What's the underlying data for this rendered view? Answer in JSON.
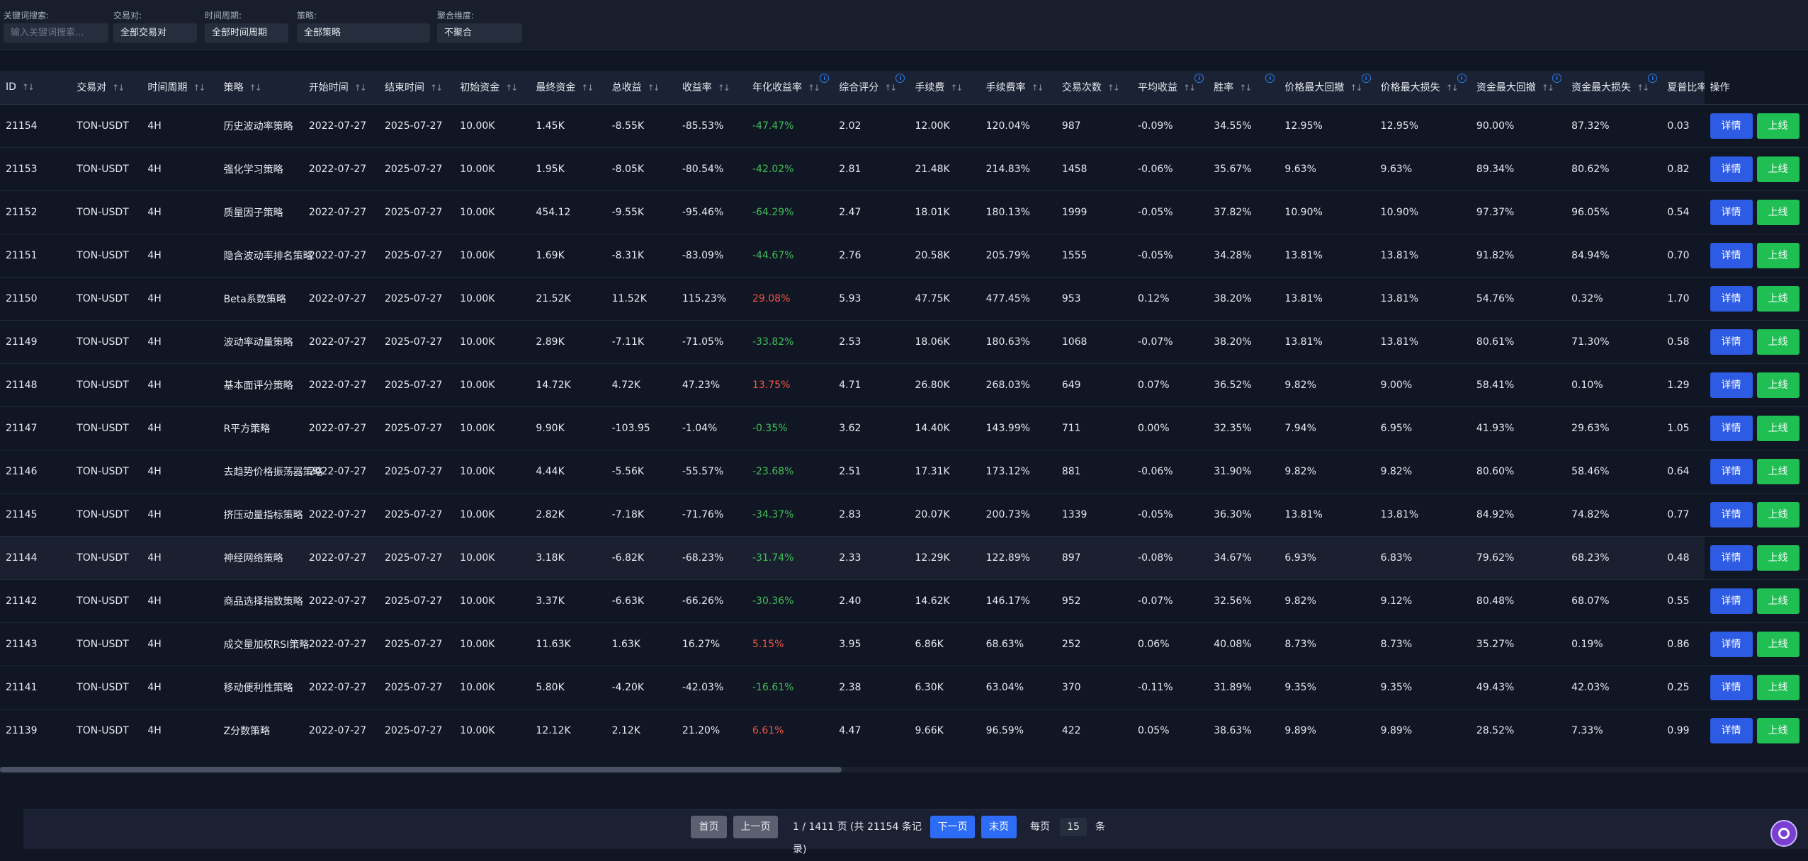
{
  "filters": {
    "keyword": {
      "label": "关键词搜索:",
      "placeholder": "输入关键词搜索..."
    },
    "pair": {
      "label": "交易对:",
      "value": "全部交易对"
    },
    "period": {
      "label": "时间周期:",
      "value": "全部时间周期"
    },
    "strategy": {
      "label": "策略:",
      "value": "全部策略"
    },
    "aggregate": {
      "label": "聚合维度:",
      "value": "不聚合"
    }
  },
  "columns": [
    "ID",
    "交易对",
    "时间周期",
    "策略",
    "开始时间",
    "结束时间",
    "初始资金",
    "最终资金",
    "总收益",
    "收益率",
    "年化收益率",
    "综合评分",
    "手续费",
    "手续费率",
    "交易次数",
    "平均收益",
    "胜率",
    "价格最大回撤",
    "价格最大损失",
    "资金最大回撤",
    "资金最大损失",
    "夏普比率",
    "操作"
  ],
  "actions": {
    "detail": "详情",
    "online": "上线"
  },
  "rows": [
    [
      "21154",
      "TON-USDT",
      "4H",
      "历史波动率策略",
      "2022-07-27",
      "2025-07-27",
      "10.00K",
      "1.45K",
      "-8.55K",
      "-85.53%",
      "-47.47%",
      "2.02",
      "12.00K",
      "120.04%",
      "987",
      "-0.09%",
      "34.55%",
      "12.95%",
      "12.95%",
      "90.00%",
      "87.32%",
      "0.03"
    ],
    [
      "21153",
      "TON-USDT",
      "4H",
      "强化学习策略",
      "2022-07-27",
      "2025-07-27",
      "10.00K",
      "1.95K",
      "-8.05K",
      "-80.54%",
      "-42.02%",
      "2.81",
      "21.48K",
      "214.83%",
      "1458",
      "-0.06%",
      "35.67%",
      "9.63%",
      "9.63%",
      "89.34%",
      "80.62%",
      "0.82"
    ],
    [
      "21152",
      "TON-USDT",
      "4H",
      "质量因子策略",
      "2022-07-27",
      "2025-07-27",
      "10.00K",
      "454.12",
      "-9.55K",
      "-95.46%",
      "-64.29%",
      "2.47",
      "18.01K",
      "180.13%",
      "1999",
      "-0.05%",
      "37.82%",
      "10.90%",
      "10.90%",
      "97.37%",
      "96.05%",
      "0.54"
    ],
    [
      "21151",
      "TON-USDT",
      "4H",
      "隐含波动率排名策略",
      "2022-07-27",
      "2025-07-27",
      "10.00K",
      "1.69K",
      "-8.31K",
      "-83.09%",
      "-44.67%",
      "2.76",
      "20.58K",
      "205.79%",
      "1555",
      "-0.05%",
      "34.28%",
      "13.81%",
      "13.81%",
      "91.82%",
      "84.94%",
      "0.70"
    ],
    [
      "21150",
      "TON-USDT",
      "4H",
      "Beta系数策略",
      "2022-07-27",
      "2025-07-27",
      "10.00K",
      "21.52K",
      "11.52K",
      "115.23%",
      "29.08%",
      "5.93",
      "47.75K",
      "477.45%",
      "953",
      "0.12%",
      "38.20%",
      "13.81%",
      "13.81%",
      "54.76%",
      "0.32%",
      "1.70"
    ],
    [
      "21149",
      "TON-USDT",
      "4H",
      "波动率动量策略",
      "2022-07-27",
      "2025-07-27",
      "10.00K",
      "2.89K",
      "-7.11K",
      "-71.05%",
      "-33.82%",
      "2.53",
      "18.06K",
      "180.63%",
      "1068",
      "-0.07%",
      "38.20%",
      "13.81%",
      "13.81%",
      "80.61%",
      "71.30%",
      "0.58"
    ],
    [
      "21148",
      "TON-USDT",
      "4H",
      "基本面评分策略",
      "2022-07-27",
      "2025-07-27",
      "10.00K",
      "14.72K",
      "4.72K",
      "47.23%",
      "13.75%",
      "4.71",
      "26.80K",
      "268.03%",
      "649",
      "0.07%",
      "36.52%",
      "9.82%",
      "9.00%",
      "58.41%",
      "0.10%",
      "1.29"
    ],
    [
      "21147",
      "TON-USDT",
      "4H",
      "R平方策略",
      "2022-07-27",
      "2025-07-27",
      "10.00K",
      "9.90K",
      "-103.95",
      "-1.04%",
      "-0.35%",
      "3.62",
      "14.40K",
      "143.99%",
      "711",
      "0.00%",
      "32.35%",
      "7.94%",
      "6.95%",
      "41.93%",
      "29.63%",
      "1.05"
    ],
    [
      "21146",
      "TON-USDT",
      "4H",
      "去趋势价格振荡器策略",
      "2022-07-27",
      "2025-07-27",
      "10.00K",
      "4.44K",
      "-5.56K",
      "-55.57%",
      "-23.68%",
      "2.51",
      "17.31K",
      "173.12%",
      "881",
      "-0.06%",
      "31.90%",
      "9.82%",
      "9.82%",
      "80.60%",
      "58.46%",
      "0.64"
    ],
    [
      "21145",
      "TON-USDT",
      "4H",
      "挤压动量指标策略",
      "2022-07-27",
      "2025-07-27",
      "10.00K",
      "2.82K",
      "-7.18K",
      "-71.76%",
      "-34.37%",
      "2.83",
      "20.07K",
      "200.73%",
      "1339",
      "-0.05%",
      "36.30%",
      "13.81%",
      "13.81%",
      "84.92%",
      "74.82%",
      "0.77"
    ],
    [
      "21144",
      "TON-USDT",
      "4H",
      "神经网络策略",
      "2022-07-27",
      "2025-07-27",
      "10.00K",
      "3.18K",
      "-6.82K",
      "-68.23%",
      "-31.74%",
      "2.33",
      "12.29K",
      "122.89%",
      "897",
      "-0.08%",
      "34.67%",
      "6.93%",
      "6.83%",
      "79.62%",
      "68.23%",
      "0.48"
    ],
    [
      "21142",
      "TON-USDT",
      "4H",
      "商品选择指数策略",
      "2022-07-27",
      "2025-07-27",
      "10.00K",
      "3.37K",
      "-6.63K",
      "-66.26%",
      "-30.36%",
      "2.40",
      "14.62K",
      "146.17%",
      "952",
      "-0.07%",
      "32.56%",
      "9.82%",
      "9.12%",
      "80.48%",
      "68.07%",
      "0.55"
    ],
    [
      "21143",
      "TON-USDT",
      "4H",
      "成交量加权RSI策略",
      "2022-07-27",
      "2025-07-27",
      "10.00K",
      "11.63K",
      "1.63K",
      "16.27%",
      "5.15%",
      "3.95",
      "6.86K",
      "68.63%",
      "252",
      "0.06%",
      "40.08%",
      "8.73%",
      "8.73%",
      "35.27%",
      "0.19%",
      "0.86"
    ],
    [
      "21141",
      "TON-USDT",
      "4H",
      "移动便利性策略",
      "2022-07-27",
      "2025-07-27",
      "10.00K",
      "5.80K",
      "-4.20K",
      "-42.03%",
      "-16.61%",
      "2.38",
      "6.30K",
      "63.04%",
      "370",
      "-0.11%",
      "31.89%",
      "9.35%",
      "9.35%",
      "49.43%",
      "42.03%",
      "0.25"
    ],
    [
      "21139",
      "TON-USDT",
      "4H",
      "Z分数策略",
      "2022-07-27",
      "2025-07-27",
      "10.00K",
      "12.12K",
      "2.12K",
      "21.20%",
      "6.61%",
      "4.47",
      "9.66K",
      "96.59%",
      "422",
      "0.05%",
      "38.63%",
      "9.89%",
      "9.89%",
      "28.52%",
      "7.33%",
      "0.99"
    ]
  ],
  "pagination": {
    "first": "首页",
    "prev": "上一页",
    "info": "1 / 1411 页 (共 21154 条记录)",
    "next": "下一页",
    "last": "末页",
    "per_page_label": "每页",
    "per_page_value": "15",
    "unit": "条"
  },
  "colors": {
    "positive": "#f05545",
    "negative": "#3fbf57",
    "button_blue": "#2d5be3",
    "button_green": "#1fbf54"
  }
}
